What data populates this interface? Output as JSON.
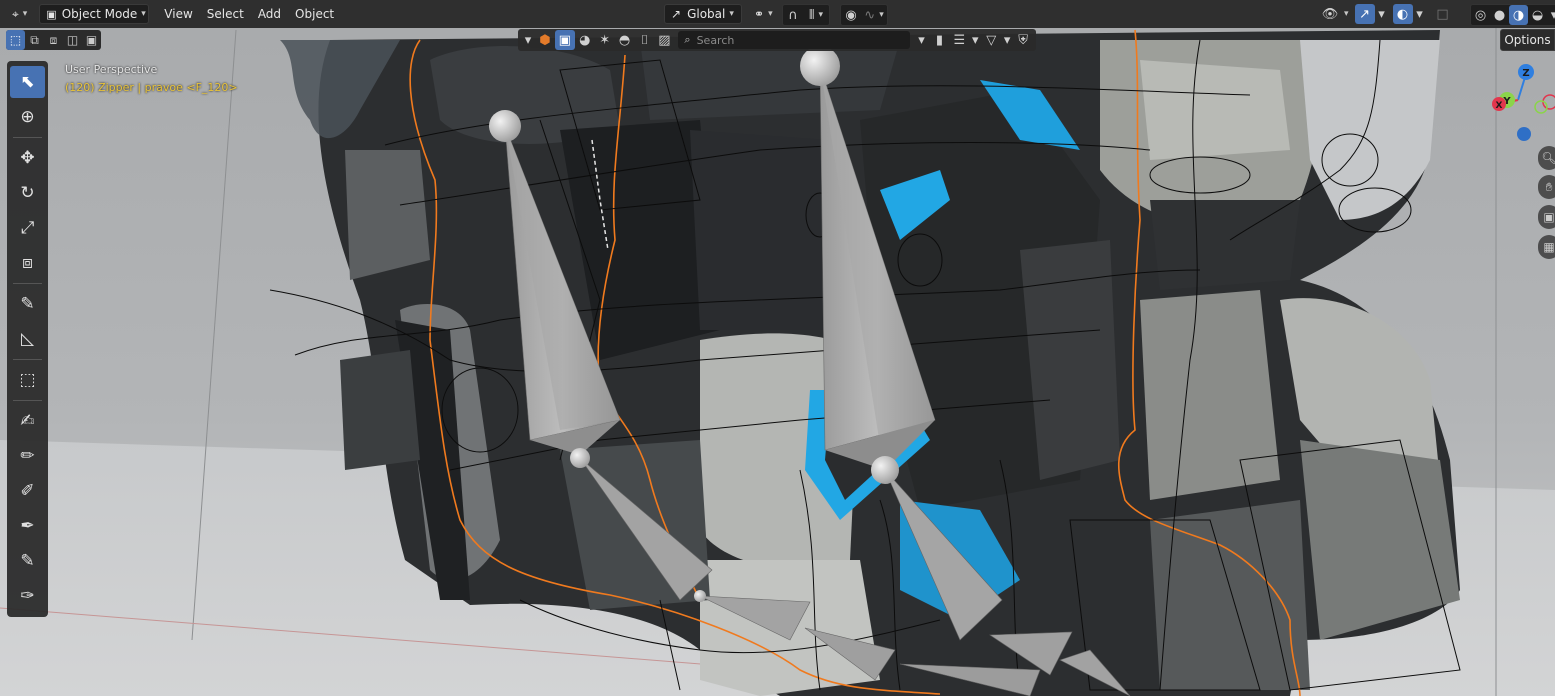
{
  "header": {
    "mode_label": "Object Mode",
    "menus": [
      "View",
      "Select",
      "Add",
      "Object"
    ],
    "orientation_label": "Global"
  },
  "filter": {
    "search_placeholder": "Search"
  },
  "options_label": "Options",
  "viewport": {
    "view_name": "User Perspective",
    "object_info": "(120) Zipper | pravoe <F_120>"
  },
  "gizmo": {
    "z": "Z",
    "y": "Y",
    "x": "X",
    "colors": {
      "x": "#e2364d",
      "y": "#8bd44a",
      "z": "#2f7fe0"
    }
  },
  "colors": {
    "accent": "#4772b3",
    "selection_outline": "#f07a1e",
    "info_text": "#e8c33a"
  }
}
